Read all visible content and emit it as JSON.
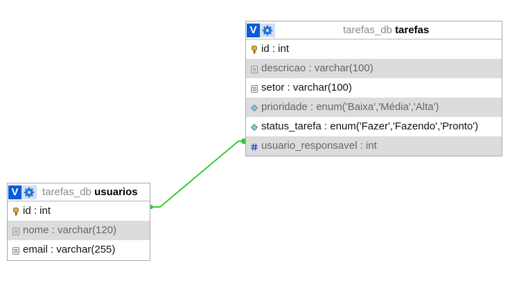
{
  "colors": {
    "link": "#33cc33",
    "v_button": "#0a5bd8",
    "gear": "#1a74d9",
    "key_icon": "#b8912c",
    "hash_icon": "#2a48c9",
    "diamond_icon": "#5aa2b0"
  },
  "tables": {
    "tarefas": {
      "v_label": "V",
      "db": "tarefas_db",
      "name": "tarefas",
      "columns": [
        {
          "text": "id : int",
          "icon": "key-icon"
        },
        {
          "text": "descricao : varchar(100)",
          "icon": "field-icon"
        },
        {
          "text": "setor : varchar(100)",
          "icon": "field-icon"
        },
        {
          "text": "prioridade : enum('Baixa','Média','Alta')",
          "icon": "enum-icon"
        },
        {
          "text": "status_tarefa : enum('Fazer','Fazendo','Pronto')",
          "icon": "enum-icon"
        },
        {
          "text": "usuario_responsavel : int",
          "icon": "hash-icon"
        }
      ]
    },
    "usuarios": {
      "v_label": "V",
      "db": "tarefas_db",
      "name": "usuarios",
      "columns": [
        {
          "text": "id : int",
          "icon": "key-icon"
        },
        {
          "text": "nome : varchar(120)",
          "icon": "field-icon"
        },
        {
          "text": "email : varchar(255)",
          "icon": "field-icon"
        }
      ]
    }
  }
}
